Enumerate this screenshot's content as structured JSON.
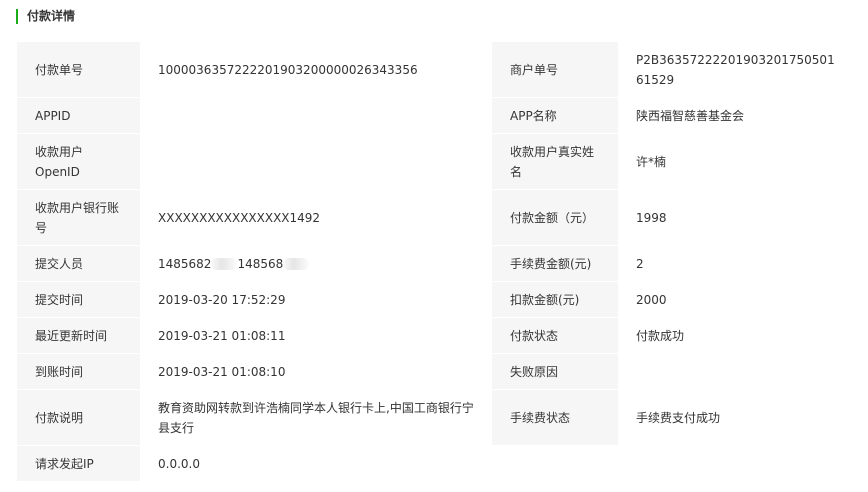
{
  "section_title": "付款详情",
  "rows": [
    {
      "label1": "付款单号",
      "value1": "1000036357222201903200000026343356",
      "label2": "商户单号",
      "value2": "P2B36357222201903201750501 61529"
    },
    {
      "label1": "APPID",
      "value1": "",
      "label2": "APP名称",
      "value2": "陕西福智慈善基金会"
    },
    {
      "label1": "收款用户OpenID",
      "value1": "",
      "label2": "收款用户真实姓名",
      "value2": "许*楠"
    },
    {
      "label1": "收款用户银行账号",
      "value1": "XXXXXXXXXXXXXXXX1492",
      "label2": "付款金额（元）",
      "value2": "1998"
    },
    {
      "label1": "提交人员",
      "value1_part1": "1485682",
      "value1_part2": "148568",
      "label2": "手续费金额(元)",
      "value2": "2"
    },
    {
      "label1": "提交时间",
      "value1": "2019-03-20 17:52:29",
      "label2": "扣款金额(元)",
      "value2": "2000"
    },
    {
      "label1": "最近更新时间",
      "value1": "2019-03-21 01:08:11",
      "label2": "付款状态",
      "value2": "付款成功"
    },
    {
      "label1": "到账时间",
      "value1": "2019-03-21 01:08:10",
      "label2": "失败原因",
      "value2": ""
    },
    {
      "label1": "付款说明",
      "value1": "教育资助网转款到许浩楠同学本人银行卡上,中国工商银行宁县支行",
      "label2": "手续费状态",
      "value2": "手续费支付成功"
    },
    {
      "label1": "请求发起IP",
      "value1": "0.0.0.0"
    }
  ],
  "colors": {
    "accent": "#1aad19",
    "label_bg": "#f6f6f6",
    "text": "#333333"
  }
}
